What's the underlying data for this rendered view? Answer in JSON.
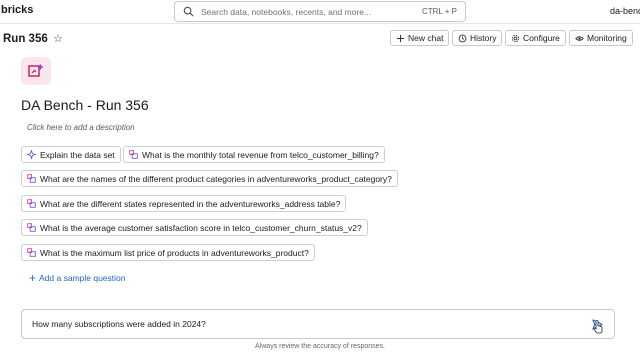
{
  "app": {
    "brand": "bricks",
    "user": "da-benc"
  },
  "search": {
    "placeholder": "Search data, notebooks, recents, and more...",
    "shortcut": "CTRL + P"
  },
  "header": {
    "title": "Run 356",
    "buttons": {
      "new_chat": "New chat",
      "history": "History",
      "configure": "Configure",
      "monitoring": "Monitoring"
    }
  },
  "main": {
    "title": "DA Bench - Run 356",
    "description_placeholder": "Click here to add a description",
    "samples": [
      "Explain the data set",
      "What is the monthly total revenue from telco_customer_billing?",
      "What are the names of the different product categories in adventureworks_product_category?",
      "What are the different states represented in the adventureworks_address table?",
      "What is the average customer satisfaction score in telco_customer_churn_status_v2?",
      "What is the maximum list price of products in adventureworks_product?"
    ],
    "add_sample_label": "Add a sample question"
  },
  "composer": {
    "value": "How many subscriptions were added in 2024?",
    "footnote": "Always review the accuracy of responses."
  },
  "colors": {
    "accent": "#2466c7",
    "icon_pink": "#d6336c",
    "icon_purple": "#7b3fe4",
    "hero_bg": "#fbe6ee"
  },
  "icons": [
    "search-icon",
    "star-icon",
    "plus-icon",
    "history-icon",
    "gear-icon",
    "eye-icon",
    "sparkle-icon",
    "table-chat-icon",
    "send-icon"
  ]
}
